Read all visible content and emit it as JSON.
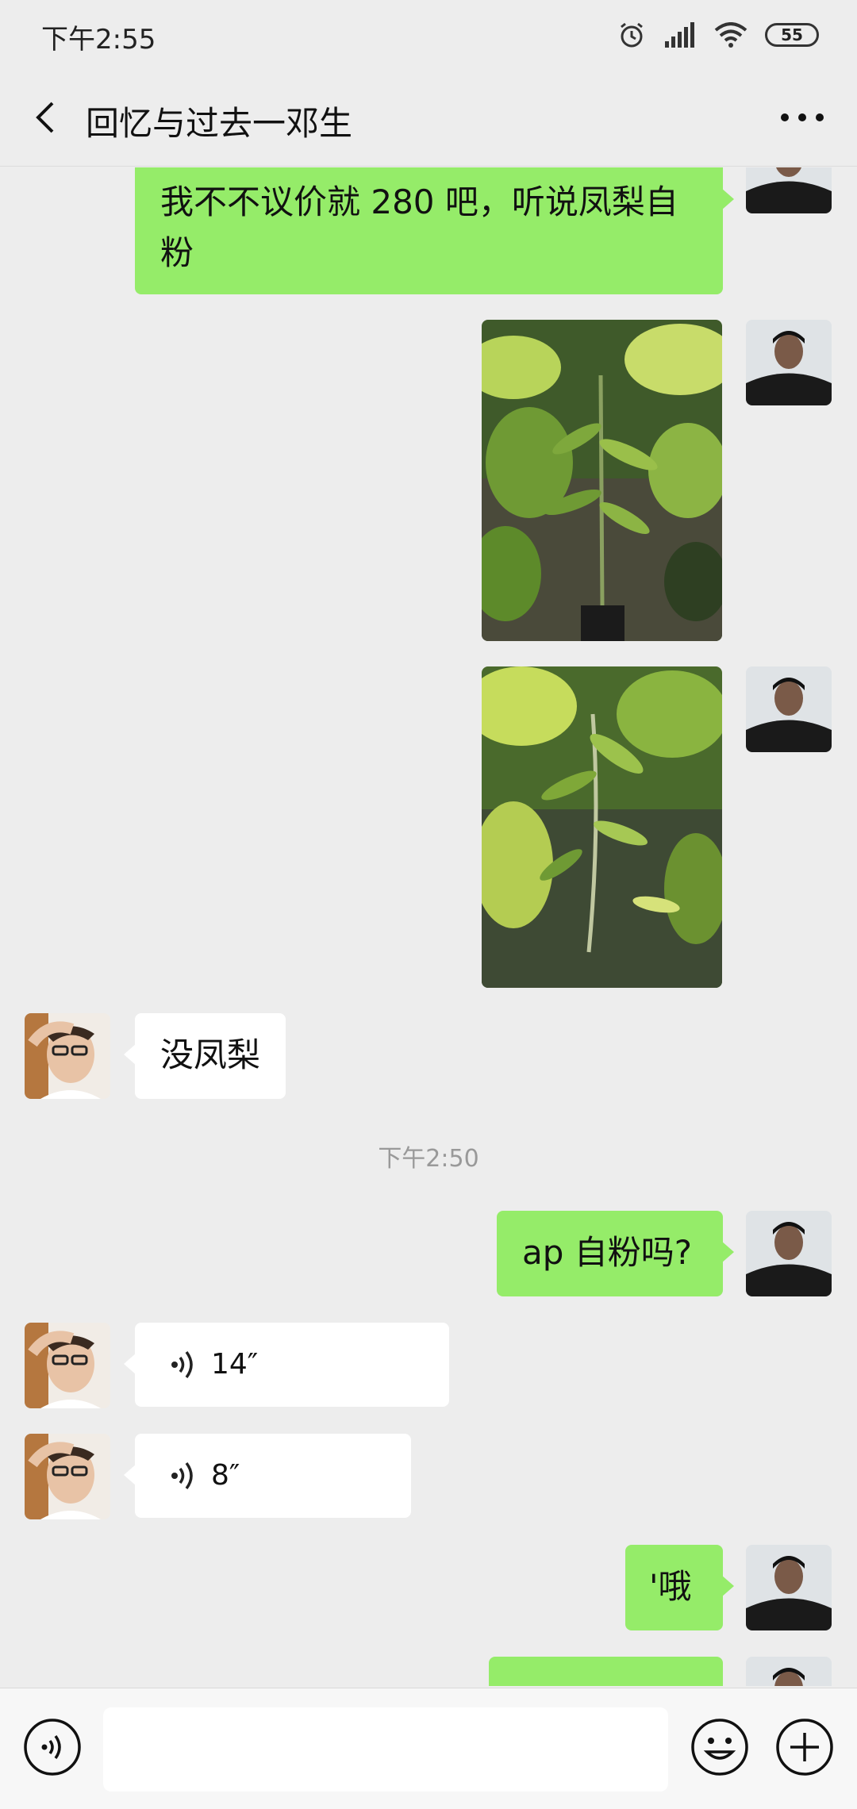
{
  "status_bar": {
    "time": "下午2:55",
    "battery": "55"
  },
  "header": {
    "title": "回忆与过去一邓生"
  },
  "messages": {
    "msg1_text": "我不不议价就 280 吧，听说凤梨自粉",
    "msg2_text": "没凤梨",
    "timestamp": "下午2:50",
    "msg3_text": "ap 自粉吗?",
    "voice1_duration": "14″",
    "voice2_duration": "8″",
    "msg4_text": "'哦"
  },
  "icons": {
    "back": "chevron-left-icon",
    "more": "more-icon",
    "voice": "voice-icon",
    "emoji": "emoji-icon",
    "plus": "plus-icon"
  },
  "colors": {
    "my_bubble": "#95ec69",
    "other_bubble": "#ffffff",
    "background": "#ededed"
  }
}
